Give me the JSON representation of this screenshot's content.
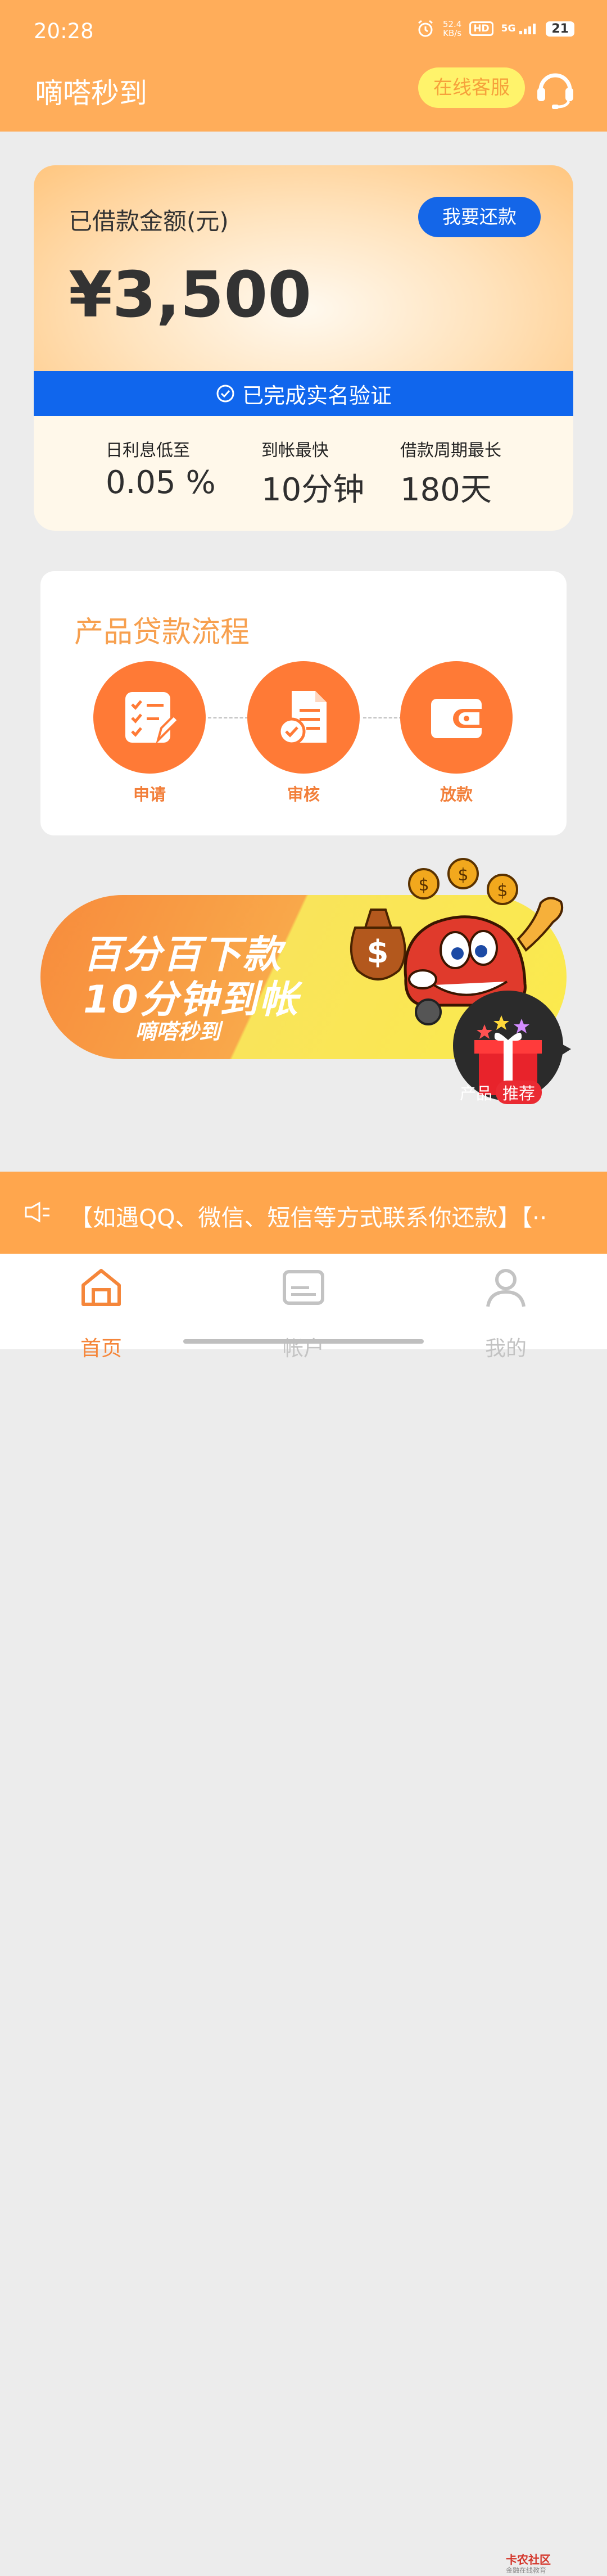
{
  "status_bar": {
    "time": "20:28",
    "speed_value": "52.4",
    "speed_unit": "KB/s",
    "hd": "HD",
    "network": "5G",
    "battery": "21"
  },
  "header": {
    "title": "嘀嗒秒到",
    "service_label": "在线客服",
    "service_icon": "headset-icon"
  },
  "loan": {
    "label": "已借款金额(元)",
    "amount": "¥3,500",
    "repay_label": "我要还款",
    "verified_text": "已完成实名验证",
    "stats": [
      {
        "label": "日利息低至",
        "value": "0.05 %"
      },
      {
        "label": "到帐最快",
        "value": "10分钟"
      },
      {
        "label": "借款周期最长",
        "value": "180天"
      }
    ]
  },
  "process": {
    "title": "产品贷款流程",
    "steps": [
      {
        "label": "申请",
        "icon": "checklist-icon"
      },
      {
        "label": "审核",
        "icon": "document-check-icon"
      },
      {
        "label": "放款",
        "icon": "wallet-icon"
      }
    ]
  },
  "banner": {
    "line1": "百分百下款",
    "line2": "10分钟到帐",
    "line3": "嘀嗒秒到"
  },
  "badge": {
    "part1": "产品",
    "part2": "推荐"
  },
  "notice": {
    "text": "【如遇QQ、微信、短信等方式联系你还款】【··"
  },
  "tabs": [
    {
      "label": "首页",
      "icon": "home-icon",
      "active": true
    },
    {
      "label": "帐户",
      "icon": "card-icon",
      "active": false
    },
    {
      "label": "我的",
      "icon": "user-icon",
      "active": false
    }
  ],
  "watermark": {
    "line1": "卡农社区",
    "line2": "金融在线教育"
  },
  "colors": {
    "brand_orange": "#ffad5a",
    "accent_blue": "#1466e8",
    "step_orange": "#ff7a36",
    "active_tab": "#f5863a",
    "inactive_tab": "#c3c3c3"
  }
}
